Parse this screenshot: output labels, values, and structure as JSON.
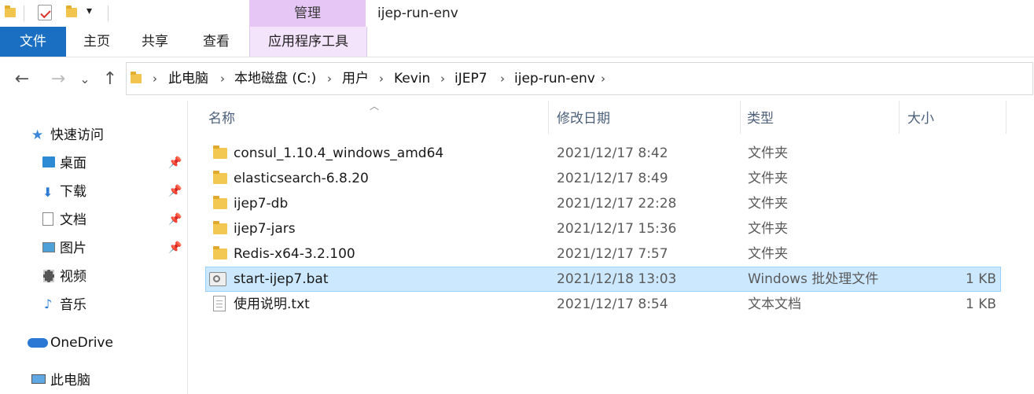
{
  "titlebar": {
    "manage_label": "管理",
    "window_title": "ijep-run-env",
    "dropdown_glyph": "▾"
  },
  "ribbon": {
    "tabs": [
      {
        "label": "文件"
      },
      {
        "label": "主页"
      },
      {
        "label": "共享"
      },
      {
        "label": "查看"
      },
      {
        "label": "应用程序工具"
      }
    ],
    "active_color": "#1a6fc2",
    "manage_color": "#e6c6f5"
  },
  "nav": {
    "back": "←",
    "forward": "→",
    "recent": "⌄",
    "up": "↑"
  },
  "breadcrumb": [
    "此电脑",
    "本地磁盘 (C:)",
    "用户",
    "Kevin",
    "iJEP7",
    "ijep-run-env"
  ],
  "navpane": {
    "quick_access": "快速访问",
    "items": [
      {
        "label": "桌面",
        "icon": "desktop-icon",
        "pinned": true
      },
      {
        "label": "下载",
        "icon": "download-icon",
        "pinned": true
      },
      {
        "label": "文档",
        "icon": "documents-icon",
        "pinned": true
      },
      {
        "label": "图片",
        "icon": "pictures-icon",
        "pinned": true
      },
      {
        "label": "视频",
        "icon": "videos-icon",
        "pinned": false
      },
      {
        "label": "音乐",
        "icon": "music-icon",
        "pinned": false
      }
    ],
    "onedrive": "OneDrive",
    "this_pc": "此电脑"
  },
  "columns": {
    "name": "名称",
    "date": "修改日期",
    "type": "类型",
    "size": "大小"
  },
  "files": [
    {
      "name": "consul_1.10.4_windows_amd64",
      "date": "2021/12/17 8:42",
      "type": "文件夹",
      "size": "",
      "kind": "folder"
    },
    {
      "name": "elasticsearch-6.8.20",
      "date": "2021/12/17 8:49",
      "type": "文件夹",
      "size": "",
      "kind": "folder"
    },
    {
      "name": "ijep7-db",
      "date": "2021/12/17 22:28",
      "type": "文件夹",
      "size": "",
      "kind": "folder"
    },
    {
      "name": "ijep7-jars",
      "date": "2021/12/17 15:36",
      "type": "文件夹",
      "size": "",
      "kind": "folder"
    },
    {
      "name": "Redis-x64-3.2.100",
      "date": "2021/12/17 7:57",
      "type": "文件夹",
      "size": "",
      "kind": "folder"
    },
    {
      "name": "start-ijep7.bat",
      "date": "2021/12/18 13:03",
      "type": "Windows 批处理文件",
      "size": "1 KB",
      "kind": "bat",
      "selected": true
    },
    {
      "name": "使用说明.txt",
      "date": "2021/12/17 8:54",
      "type": "文本文档",
      "size": "1 KB",
      "kind": "txt"
    }
  ]
}
